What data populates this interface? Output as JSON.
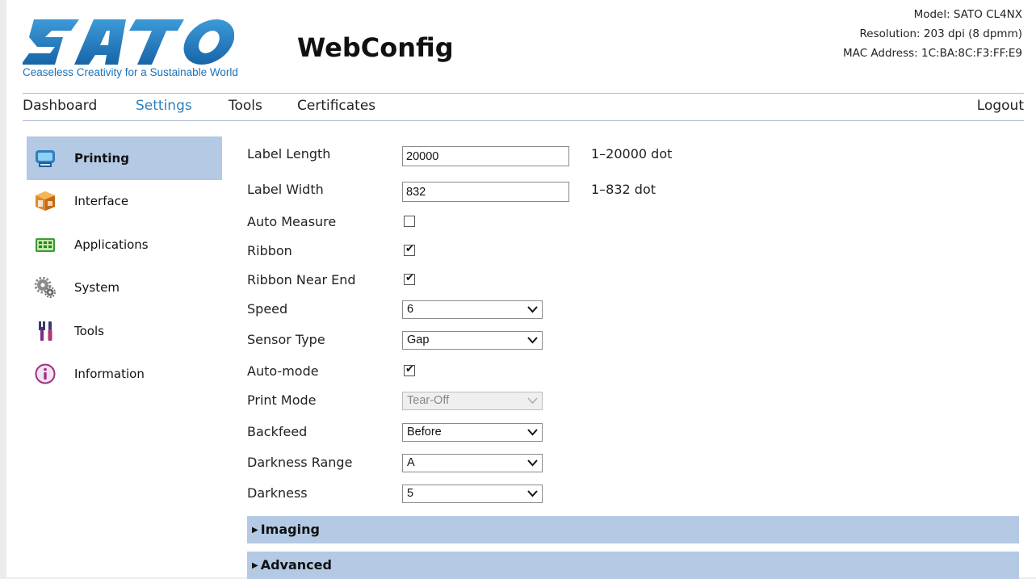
{
  "header": {
    "tagline": "Ceaseless Creativity for a Sustainable World",
    "app_title": "WebConfig",
    "model": "Model: SATO CL4NX",
    "resolution": "Resolution: 203 dpi (8 dpmm)",
    "mac": "MAC Address: 1C:BA:8C:F3:FF:E9",
    "brand_color": "#1b72b8"
  },
  "nav": {
    "dashboard": "Dashboard",
    "settings": "Settings",
    "tools": "Tools",
    "certificates": "Certificates",
    "logout": "Logout",
    "active": "Settings"
  },
  "sidebar": {
    "items": [
      {
        "label": "Printing",
        "icon": "printer-icon",
        "active": true
      },
      {
        "label": "Interface",
        "icon": "interface-box-icon",
        "active": false
      },
      {
        "label": "Applications",
        "icon": "applications-icon",
        "active": false
      },
      {
        "label": "System",
        "icon": "gears-icon",
        "active": false
      },
      {
        "label": "Tools",
        "icon": "tools-icon",
        "active": false
      },
      {
        "label": "Information",
        "icon": "info-icon",
        "active": false
      }
    ]
  },
  "form": {
    "label_length": {
      "label": "Label Length",
      "value": "20000",
      "hint": "1–20000 dot"
    },
    "label_width": {
      "label": "Label Width",
      "value": "832",
      "hint": "1–832 dot"
    },
    "auto_measure": {
      "label": "Auto Measure",
      "checked": false
    },
    "ribbon": {
      "label": "Ribbon",
      "checked": true
    },
    "ribbon_near_end": {
      "label": "Ribbon Near End",
      "checked": true
    },
    "speed": {
      "label": "Speed",
      "value": "6"
    },
    "sensor_type": {
      "label": "Sensor Type",
      "value": "Gap"
    },
    "auto_mode": {
      "label": "Auto-mode",
      "checked": true
    },
    "print_mode": {
      "label": "Print Mode",
      "value": "Tear-Off",
      "disabled": true
    },
    "backfeed": {
      "label": "Backfeed",
      "value": "Before"
    },
    "darkness_range": {
      "label": "Darkness Range",
      "value": "A"
    },
    "darkness": {
      "label": "Darkness",
      "value": "5"
    }
  },
  "sections": {
    "imaging": "Imaging",
    "advanced": "Advanced"
  },
  "colors": {
    "active_bg": "#b3c9e4",
    "active_nav": "#2f7fbd"
  }
}
